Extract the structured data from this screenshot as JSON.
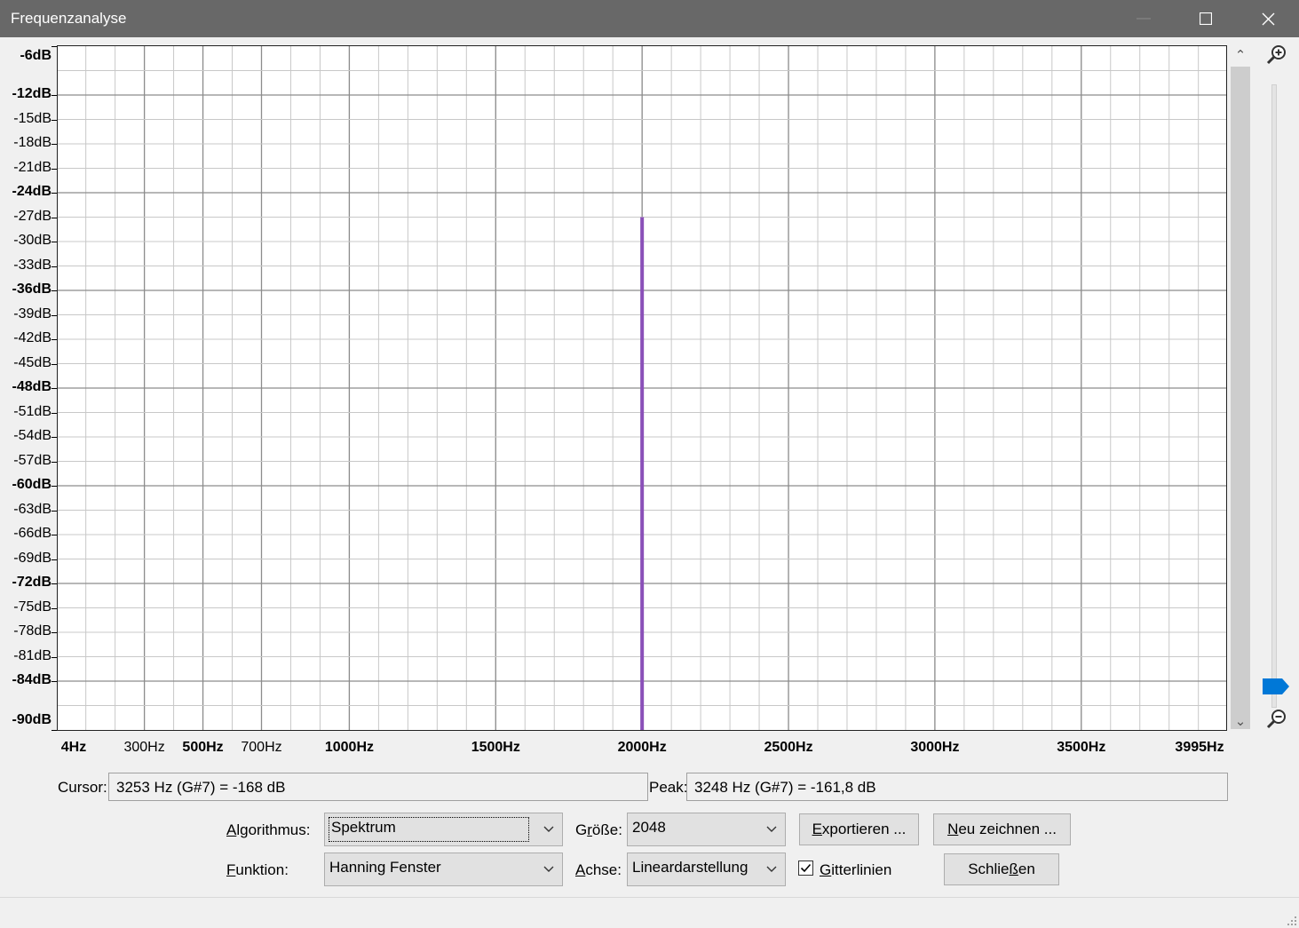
{
  "window": {
    "title": "Frequenzanalyse",
    "minimize": "—",
    "maximize": "☐",
    "close": "✕"
  },
  "chart_data": {
    "type": "line",
    "title": "",
    "xlabel": "",
    "ylabel": "",
    "xlim": [
      4,
      3995
    ],
    "ylim": [
      -90,
      -6
    ],
    "grid": true,
    "x_ticks": [
      "4Hz",
      "300Hz",
      "500Hz",
      "700Hz",
      "1000Hz",
      "1500Hz",
      "2000Hz",
      "2500Hz",
      "3000Hz",
      "3500Hz",
      "3995Hz"
    ],
    "y_ticks": [
      "-6dB",
      "-12dB",
      "-15dB",
      "-18dB",
      "-21dB",
      "-24dB",
      "-27dB",
      "-30dB",
      "-33dB",
      "-36dB",
      "-39dB",
      "-42dB",
      "-45dB",
      "-48dB",
      "-51dB",
      "-54dB",
      "-57dB",
      "-60dB",
      "-63dB",
      "-66dB",
      "-69dB",
      "-72dB",
      "-75dB",
      "-78dB",
      "-81dB",
      "-84dB",
      "-90dB"
    ],
    "series": [
      {
        "color": "#8a50b8",
        "peak_hz": 2000,
        "peak_db": -27,
        "floor_db": -90
      }
    ]
  },
  "readouts": {
    "cursor_label": "Cursor:",
    "cursor_value": "3253 Hz (G#7) = -168 dB",
    "peak_label": "Peak:",
    "peak_value": "3248 Hz (G#7) = -161,8 dB"
  },
  "controls": {
    "algorithm_label": "Algorithmus:",
    "algorithm_value": "Spektrum",
    "size_label": "Größe:",
    "size_value": "2048",
    "function_label": "Funktion:",
    "function_value": "Hanning Fenster",
    "axis_label": "Achse:",
    "axis_value": "Lineardarstellung",
    "grid_label": "Gitterlinien",
    "grid_checked": true,
    "export_button": "Exportieren ...",
    "redraw_button": "Neu zeichnen ...",
    "close_button": "Schließen"
  }
}
